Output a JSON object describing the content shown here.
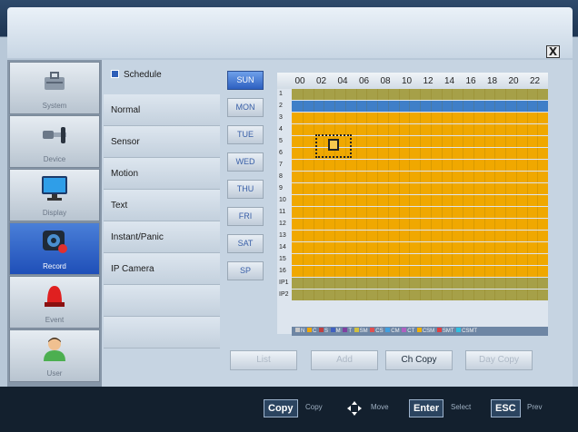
{
  "close_label": "X",
  "sidebar": {
    "items": [
      {
        "label": "System",
        "icon": "toolbox-icon"
      },
      {
        "label": "Device",
        "icon": "cable-icon"
      },
      {
        "label": "Display",
        "icon": "monitor-icon"
      },
      {
        "label": "Record",
        "icon": "camera-record-icon",
        "active": true
      },
      {
        "label": "Event",
        "icon": "alarm-light-icon"
      },
      {
        "label": "User",
        "icon": "user-icon"
      }
    ]
  },
  "submenu": {
    "header": "Schedule",
    "items": [
      "Normal",
      "Sensor",
      "Motion",
      "Text",
      "Instant/Panic",
      "IP Camera",
      "",
      ""
    ]
  },
  "days": [
    "SUN",
    "MON",
    "TUE",
    "WED",
    "THU",
    "FRI",
    "SAT",
    "SP"
  ],
  "active_day": "SUN",
  "hours": [
    "00",
    "02",
    "04",
    "06",
    "08",
    "10",
    "12",
    "14",
    "16",
    "18",
    "20",
    "22"
  ],
  "rows": [
    "1",
    "2",
    "3",
    "4",
    "5",
    "6",
    "7",
    "8",
    "9",
    "10",
    "11",
    "12",
    "13",
    "14",
    "15",
    "16",
    "IP1",
    "IP2"
  ],
  "legend": [
    {
      "label": "N",
      "color": "#c8c8c8"
    },
    {
      "label": "C",
      "color": "#f0a800"
    },
    {
      "label": "S",
      "color": "#c04040"
    },
    {
      "label": "M",
      "color": "#4060c0"
    },
    {
      "label": "T",
      "color": "#8040a0"
    },
    {
      "label": "SM",
      "color": "#d0c040"
    },
    {
      "label": "CS",
      "color": "#e05050"
    },
    {
      "label": "CM",
      "color": "#40a0e0"
    },
    {
      "label": "CT",
      "color": "#b060c0"
    },
    {
      "label": "CSM",
      "color": "#f0b000"
    },
    {
      "label": "SMT",
      "color": "#e04040"
    },
    {
      "label": "CSMT",
      "color": "#30c0e0"
    }
  ],
  "buttons": {
    "list": "List",
    "add": "Add",
    "ch_copy": "Ch Copy",
    "day_copy": "Day Copy"
  },
  "footer": {
    "copy_key": "Copy",
    "copy_label": "Copy",
    "move_label": "Move",
    "enter_key": "Enter",
    "enter_label": "Select",
    "esc_key": "ESC",
    "esc_label": "Prev"
  },
  "colors": {
    "normal": "#f0a800",
    "sensor_row": "#a6a048",
    "highlight": "#3f7fc8",
    "accent": "#2d60c0"
  }
}
